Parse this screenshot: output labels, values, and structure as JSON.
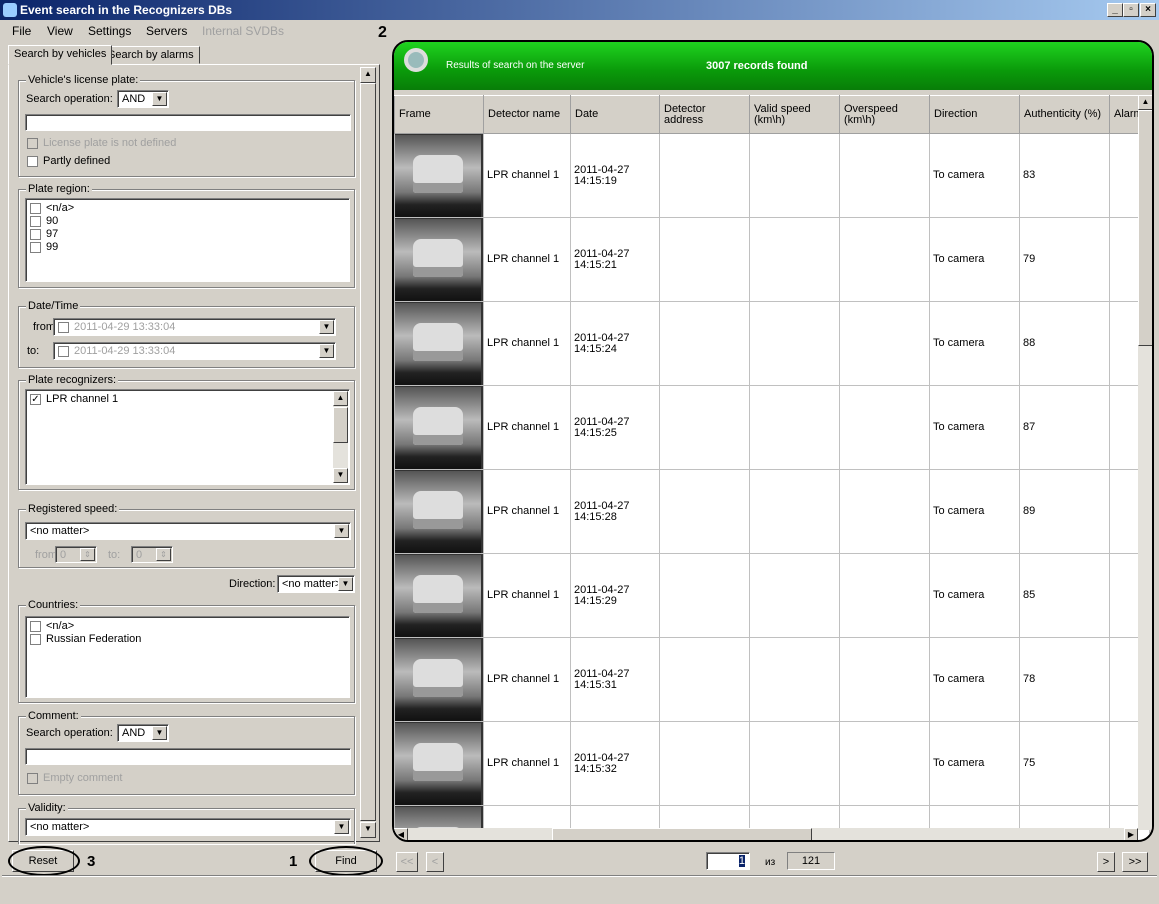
{
  "window": {
    "title": "Event search in the Recognizers DBs",
    "controls": [
      "_",
      "▫",
      "×"
    ]
  },
  "menu": [
    "File",
    "View",
    "Settings",
    "Servers",
    "Internal SVDBs"
  ],
  "tabs": [
    "Search by vehicles",
    "Search by alarms"
  ],
  "annotations": {
    "find": "1",
    "results": "2",
    "reset": "3"
  },
  "filters": {
    "license_plate": {
      "label": "Vehicle's license plate:",
      "search_op_label": "Search operation:",
      "search_op": "AND",
      "value": "",
      "not_defined": "License plate is not defined",
      "partly": "Partly defined"
    },
    "plate_region": {
      "label": "Plate region:",
      "items": [
        "<n/a>",
        "90",
        "97",
        "99"
      ]
    },
    "datetime": {
      "label": "Date/Time",
      "from_label": "from",
      "to_label": "to:",
      "from": "2011-04-29 13:33:04",
      "to": "2011-04-29 13:33:04"
    },
    "recognizers": {
      "label": "Plate recognizers:",
      "items": [
        {
          "name": "LPR channel 1",
          "checked": true
        }
      ]
    },
    "speed": {
      "label": "Registered speed:",
      "value": "<no matter>",
      "from_label": "from",
      "to_label": "to:",
      "from": "0",
      "to": "0"
    },
    "direction": {
      "label": "Direction:",
      "value": "<no matter>"
    },
    "countries": {
      "label": "Countries:",
      "items": [
        "<n/a>",
        "Russian Federation"
      ]
    },
    "comment": {
      "label": "Comment:",
      "search_op_label": "Search operation:",
      "search_op": "AND",
      "value": "",
      "empty": "Empty comment"
    },
    "validity": {
      "label": "Validity:",
      "value": "<no matter>"
    }
  },
  "buttons": {
    "reset": "Reset",
    "find": "Find"
  },
  "results": {
    "title": "Results of search on the server",
    "count": "3007 records found",
    "columns": [
      "Frame",
      "Detector name",
      "Date",
      "Detector address",
      "Valid speed (km\\h)",
      "Overspeed (km\\h)",
      "Direction",
      "Authenticity (%)",
      "Alarm"
    ],
    "rows": [
      {
        "detector": "LPR channel 1",
        "date": "2011-04-27 14:15:19",
        "direction": "To camera",
        "authenticity": "83"
      },
      {
        "detector": "LPR channel 1",
        "date": "2011-04-27 14:15:21",
        "direction": "To camera",
        "authenticity": "79"
      },
      {
        "detector": "LPR channel 1",
        "date": "2011-04-27 14:15:24",
        "direction": "To camera",
        "authenticity": "88"
      },
      {
        "detector": "LPR channel 1",
        "date": "2011-04-27 14:15:25",
        "direction": "To camera",
        "authenticity": "87"
      },
      {
        "detector": "LPR channel 1",
        "date": "2011-04-27 14:15:28",
        "direction": "To camera",
        "authenticity": "89"
      },
      {
        "detector": "LPR channel 1",
        "date": "2011-04-27 14:15:29",
        "direction": "To camera",
        "authenticity": "85"
      },
      {
        "detector": "LPR channel 1",
        "date": "2011-04-27 14:15:31",
        "direction": "To camera",
        "authenticity": "78"
      },
      {
        "detector": "LPR channel 1",
        "date": "2011-04-27 14:15:32",
        "direction": "To camera",
        "authenticity": "75"
      }
    ]
  },
  "pager": {
    "first": "<<",
    "prev": "<",
    "page": "1",
    "of": "из",
    "total": "121",
    "next": ">",
    "last": ">>"
  }
}
